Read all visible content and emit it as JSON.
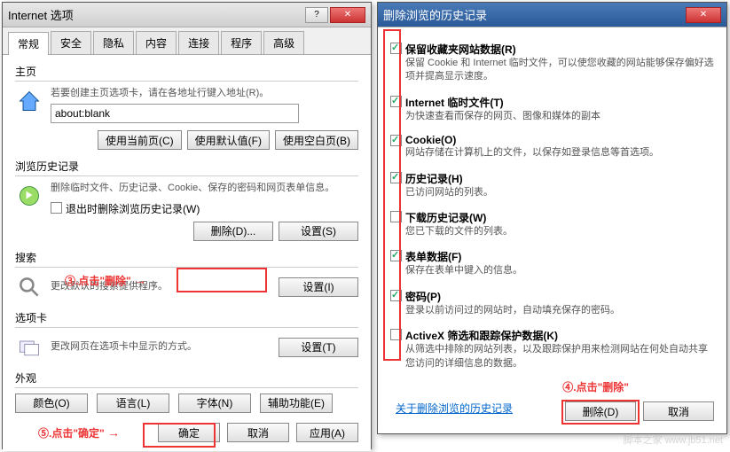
{
  "win1": {
    "title": "Internet 选项",
    "tabs": [
      "常规",
      "安全",
      "隐私",
      "内容",
      "连接",
      "程序",
      "高级"
    ],
    "homepage": {
      "title": "主页",
      "desc": "若要创建主页选项卡，请在各地址行键入地址(R)。",
      "value": "about:blank",
      "btn_current": "使用当前页(C)",
      "btn_default": "使用默认值(F)",
      "btn_blank": "使用空白页(B)"
    },
    "history": {
      "title": "浏览历史记录",
      "desc": "删除临时文件、历史记录、Cookie、保存的密码和网页表单信息。",
      "chk_exit": "退出时删除浏览历史记录(W)",
      "btn_delete": "删除(D)...",
      "btn_settings": "设置(S)"
    },
    "search": {
      "title": "搜索",
      "desc": "更改默认的搜索提供程序。",
      "btn": "设置(I)"
    },
    "tabs_section": {
      "title": "选项卡",
      "desc": "更改网页在选项卡中显示的方式。",
      "btn": "设置(T)"
    },
    "appearance": {
      "title": "外观",
      "btn_color": "颜色(O)",
      "btn_lang": "语言(L)",
      "btn_font": "字体(N)",
      "btn_access": "辅助功能(E)"
    },
    "footer": {
      "ok": "确定",
      "cancel": "取消",
      "apply": "应用(A)"
    }
  },
  "win2": {
    "title": "删除浏览的历史记录",
    "items": [
      {
        "checked": true,
        "label": "保留收藏夹网站数据(R)",
        "desc": "保留 Cookie 和 Internet 临时文件，可以使您收藏的网站能够保存偏好选项并提高显示速度。"
      },
      {
        "checked": true,
        "label": "Internet 临时文件(T)",
        "desc": "为快速查看而保存的网页、图像和媒体的副本"
      },
      {
        "checked": true,
        "label": "Cookie(O)",
        "desc": "网站存储在计算机上的文件，以保存如登录信息等首选项。"
      },
      {
        "checked": true,
        "label": "历史记录(H)",
        "desc": "已访问网站的列表。"
      },
      {
        "checked": false,
        "label": "下载历史记录(W)",
        "desc": "您已下载的文件的列表。"
      },
      {
        "checked": true,
        "label": "表单数据(F)",
        "desc": "保存在表单中键入的信息。"
      },
      {
        "checked": true,
        "label": "密码(P)",
        "desc": "登录以前访问过的网站时，自动填充保存的密码。"
      },
      {
        "checked": false,
        "label": "ActiveX 筛选和跟踪保护数据(K)",
        "desc": "从筛选中排除的网站列表，以及跟踪保护用来检测网站在何处自动共享您访问的详细信息的数据。"
      }
    ],
    "link": "关于删除浏览的历史记录",
    "btn_delete": "删除(D)",
    "btn_cancel": "取消"
  },
  "annotations": {
    "a3": "③.点击\"删除\"",
    "a4": "④.点击\"删除\"",
    "a5": "⑤.点击\"确定\""
  },
  "watermark": "脚本之家 www.jb51.net"
}
